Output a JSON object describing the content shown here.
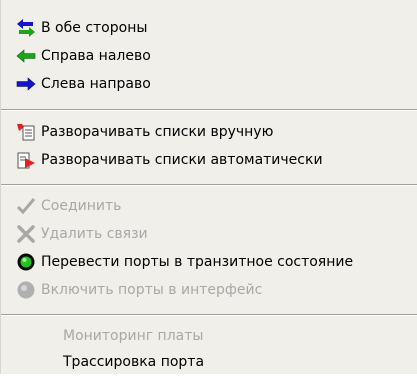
{
  "menu": {
    "items": [
      {
        "label": "В обе стороны",
        "icon": "bidirectional-arrows-icon"
      },
      {
        "label": "Справа налево",
        "icon": "green-left-arrow-icon"
      },
      {
        "label": "Слева направо",
        "icon": "blue-right-arrow-icon"
      },
      {
        "label": "Разворачивать списки вручную",
        "icon": "expand-manual-icon"
      },
      {
        "label": "Разворачивать списки автоматически",
        "icon": "expand-auto-icon"
      },
      {
        "label": "Соединить",
        "icon": "checkmark-icon",
        "disabled": true
      },
      {
        "label": "Удалить связи",
        "icon": "x-delete-icon",
        "disabled": true
      },
      {
        "label": "Перевести порты в транзитное состояние",
        "icon": "green-circle-icon"
      },
      {
        "label": "Включить порты в интерфейс",
        "icon": "gray-circle-icon",
        "disabled": true
      },
      {
        "label": "Мониторинг платы",
        "disabled": true
      },
      {
        "label": "Трассировка порта"
      }
    ]
  },
  "colors": {
    "menu_bg": "#f0efe9",
    "disabled_text": "#a8a8a8",
    "arrow_green": "#1aa51a",
    "arrow_blue": "#1414c8",
    "accent_red": "#e22020"
  }
}
